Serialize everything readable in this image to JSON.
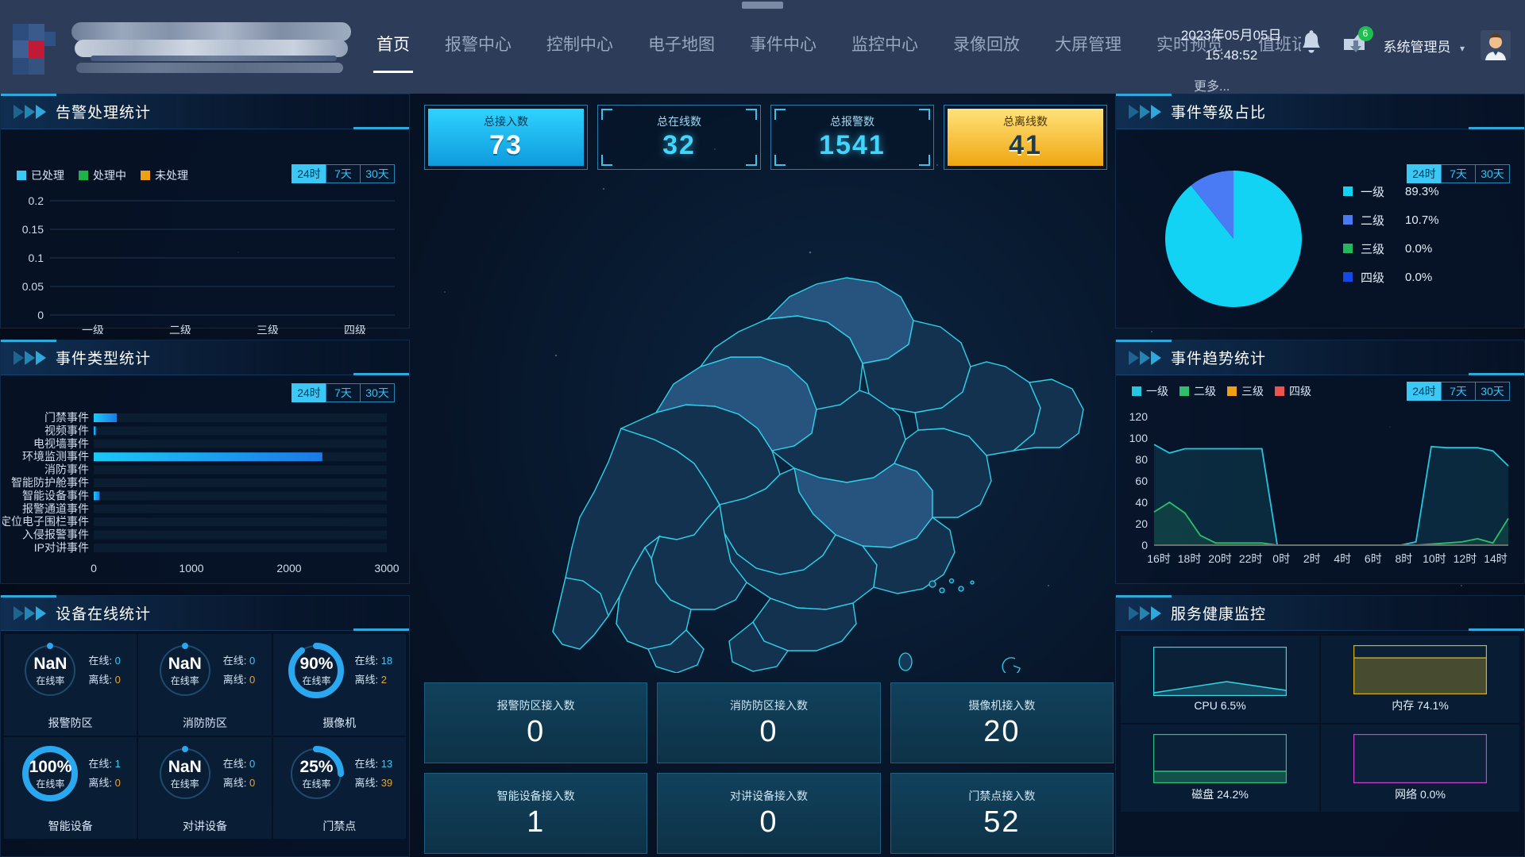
{
  "header": {
    "logo_alt": "blurred-logo",
    "nav": [
      {
        "label": "首页",
        "active": true
      },
      {
        "label": "报警中心",
        "active": false
      },
      {
        "label": "控制中心",
        "active": false
      },
      {
        "label": "电子地图",
        "active": false
      },
      {
        "label": "事件中心",
        "active": false
      },
      {
        "label": "监控中心",
        "active": false
      },
      {
        "label": "录像回放",
        "active": false
      },
      {
        "label": "大屏管理",
        "active": false
      },
      {
        "label": "实时预览",
        "active": false
      },
      {
        "label": "值班记录",
        "active": false
      }
    ],
    "more_label": "更多...",
    "date": "2023年05月05日",
    "time": "15:48:52",
    "bell_icon": "bell-icon",
    "download_icon": "download-icon",
    "download_badge": "6",
    "user_name": "系统管理员",
    "avatar_icon": "user-avatar"
  },
  "range_options": [
    "24时",
    "7天",
    "30天"
  ],
  "range_selected": "24时",
  "panels": {
    "alarm_stats": {
      "title": "告警处理统计"
    },
    "event_type": {
      "title": "事件类型统计"
    },
    "device_online": {
      "title": "设备在线统计"
    },
    "event_level": {
      "title": "事件等级占比"
    },
    "event_trend": {
      "title": "事件趋势统计"
    },
    "service_health": {
      "title": "服务健康监控"
    }
  },
  "kpis": [
    {
      "label": "总接入数",
      "value": "73",
      "style": "blue"
    },
    {
      "label": "总在线数",
      "value": "32",
      "style": "dark"
    },
    {
      "label": "总报警数",
      "value": "1541",
      "style": "dark"
    },
    {
      "label": "总离线数",
      "value": "41",
      "style": "gold"
    }
  ],
  "tiles": [
    {
      "label": "报警防区接入数",
      "value": "0"
    },
    {
      "label": "消防防区接入数",
      "value": "0"
    },
    {
      "label": "摄像机接入数",
      "value": "20"
    },
    {
      "label": "智能设备接入数",
      "value": "1"
    },
    {
      "label": "对讲设备接入数",
      "value": "0"
    },
    {
      "label": "门禁点接入数",
      "value": "52"
    }
  ],
  "devices": {
    "online_label": "在线:",
    "offline_label": "离线:",
    "rate_label": "在线率",
    "items": [
      {
        "name": "报警防区",
        "pct_text": "NaN",
        "pct": 0,
        "online": "0",
        "offline": "0"
      },
      {
        "name": "消防防区",
        "pct_text": "NaN",
        "pct": 0,
        "online": "0",
        "offline": "0"
      },
      {
        "name": "摄像机",
        "pct_text": "90%",
        "pct": 90,
        "online": "18",
        "offline": "2"
      },
      {
        "name": "智能设备",
        "pct_text": "100%",
        "pct": 100,
        "online": "1",
        "offline": "0"
      },
      {
        "name": "对讲设备",
        "pct_text": "NaN",
        "pct": 0,
        "online": "0",
        "offline": "0"
      },
      {
        "name": "门禁点",
        "pct_text": "25%",
        "pct": 25,
        "online": "13",
        "offline": "39"
      }
    ]
  },
  "health": {
    "items": [
      {
        "label": "CPU  6.5%",
        "value": 6.5,
        "color": "#35d6e6",
        "kind": "line"
      },
      {
        "label": "内存  74.1%",
        "value": 74.1,
        "color": "#d4b01e",
        "kind": "fill"
      },
      {
        "label": "磁盘  24.2%",
        "value": 24.2,
        "color": "#2fbf7a",
        "kind": "fill"
      },
      {
        "label": "网络  0.0%",
        "value": 0.0,
        "color": "#cc3fd0",
        "kind": "fill"
      }
    ]
  },
  "chart_data": [
    {
      "id": "alarm_stats",
      "type": "bar",
      "title": "告警处理统计",
      "categories": [
        "一级",
        "二级",
        "三级",
        "四级"
      ],
      "series": [
        {
          "name": "已处理",
          "color": "#3bc8f5",
          "values": [
            0,
            0,
            0,
            0
          ]
        },
        {
          "name": "处理中",
          "color": "#20b24a",
          "values": [
            0,
            0,
            0,
            0
          ]
        },
        {
          "name": "未处理",
          "color": "#f0a015",
          "values": [
            0,
            0,
            0,
            0
          ]
        }
      ],
      "yticks": [
        "0.2",
        "0.15",
        "0.1",
        "0.05",
        "0"
      ],
      "ylim": [
        0,
        0.2
      ],
      "xlabel": "",
      "ylabel": "",
      "grid": true,
      "legend_position": "top-left"
    },
    {
      "id": "event_type",
      "type": "bar",
      "orientation": "horizontal",
      "title": "事件类型统计",
      "categories": [
        "门禁事件",
        "视频事件",
        "电视墙事件",
        "环境监测事件",
        "消防事件",
        "智能防护舱事件",
        "智能设备事件",
        "报警通道事件",
        "定位电子围栏事件",
        "入侵报警事件",
        "IP对讲事件"
      ],
      "values": [
        236,
        22,
        0,
        2340,
        0,
        0,
        60,
        0,
        0,
        0,
        0
      ],
      "xticks": [
        "0",
        "1000",
        "2000",
        "3000"
      ],
      "xlim": [
        0,
        3000
      ],
      "bar_color": "#1fb6f0",
      "grid": false,
      "legend_position": "none"
    },
    {
      "id": "event_level_pie",
      "type": "pie",
      "title": "事件等级占比",
      "labels": [
        "一级",
        "二级",
        "三级",
        "四级"
      ],
      "values": [
        89.3,
        10.7,
        0.0,
        0.0
      ],
      "value_texts": [
        "89.3%",
        "10.7%",
        "0.0%",
        "0.0%"
      ],
      "colors": [
        "#13d3f5",
        "#4a7bf5",
        "#23b85b",
        "#1448e8"
      ],
      "legend_position": "right"
    },
    {
      "id": "event_trend",
      "type": "area",
      "title": "事件趋势统计",
      "x": [
        "16时",
        "17时",
        "18时",
        "19时",
        "20时",
        "21时",
        "22时",
        "23时",
        "0时",
        "1时",
        "2时",
        "3时",
        "4时",
        "5时",
        "6时",
        "7时",
        "8时",
        "9时",
        "10时",
        "11时",
        "12时",
        "13时",
        "14时",
        "15时"
      ],
      "xtick_labels": [
        "16时",
        "18时",
        "20时",
        "22时",
        "0时",
        "2时",
        "4时",
        "6时",
        "8时",
        "10时",
        "12时",
        "14时"
      ],
      "yticks": [
        0,
        20,
        40,
        60,
        80,
        100,
        120
      ],
      "ylim": [
        0,
        120
      ],
      "series": [
        {
          "name": "一级",
          "color": "#24c7e0",
          "values": [
            94,
            86,
            90,
            90,
            90,
            90,
            90,
            90,
            0,
            0,
            0,
            0,
            0,
            0,
            0,
            0,
            0,
            3,
            92,
            91,
            91,
            91,
            88,
            74
          ]
        },
        {
          "name": "二级",
          "color": "#2fbf6a",
          "values": [
            31,
            40,
            30,
            9,
            2,
            2,
            2,
            2,
            0,
            0,
            0,
            0,
            0,
            0,
            0,
            0,
            0,
            0,
            1,
            2,
            3,
            6,
            2,
            25
          ]
        },
        {
          "name": "三级",
          "color": "#f0a015",
          "values": [
            0,
            0,
            0,
            0,
            0,
            0,
            0,
            0,
            0,
            0,
            0,
            0,
            0,
            0,
            0,
            0,
            0,
            0,
            0,
            0,
            0,
            0,
            0,
            0
          ]
        },
        {
          "name": "四级",
          "color": "#ef5350",
          "values": [
            0,
            0,
            0,
            0,
            0,
            0,
            0,
            0,
            0,
            0,
            0,
            0,
            0,
            0,
            0,
            0,
            0,
            0,
            0,
            0,
            0,
            0,
            0,
            0
          ]
        }
      ],
      "grid": false,
      "legend_position": "top-left"
    }
  ]
}
